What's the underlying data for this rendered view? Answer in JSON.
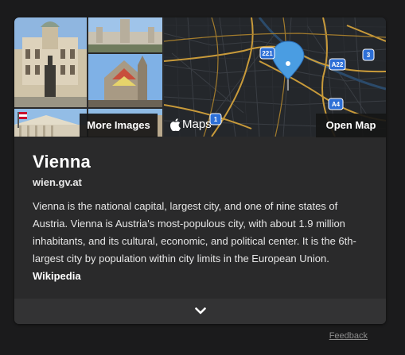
{
  "card": {
    "title": "Vienna",
    "domain": "wien.gv.at",
    "description": "Vienna is the national capital, largest city, and one of nine states of Austria. Vienna is Austria's most-populous city, with about 1.9 million inhabitants, and its cultural, economic, and political center. It is the 6th-largest city by population within city limits in the European Union.",
    "source_link": "Wikipedia"
  },
  "media": {
    "more_images_label": "More Images",
    "open_map_label": "Open Map",
    "maps_brand": "Maps",
    "map_shields": [
      "221",
      "3",
      "A22",
      "1",
      "A4"
    ]
  },
  "footer": {
    "feedback_label": "Feedback"
  },
  "colors": {
    "background": "#1b1b1c",
    "card": "#2a2a2b",
    "map_road": "#c89a3a",
    "map_pin": "#4a9de2",
    "shield": "#2d6fd6"
  },
  "icons": [
    "apple-icon",
    "map-pin-icon",
    "chevron-down-icon"
  ]
}
